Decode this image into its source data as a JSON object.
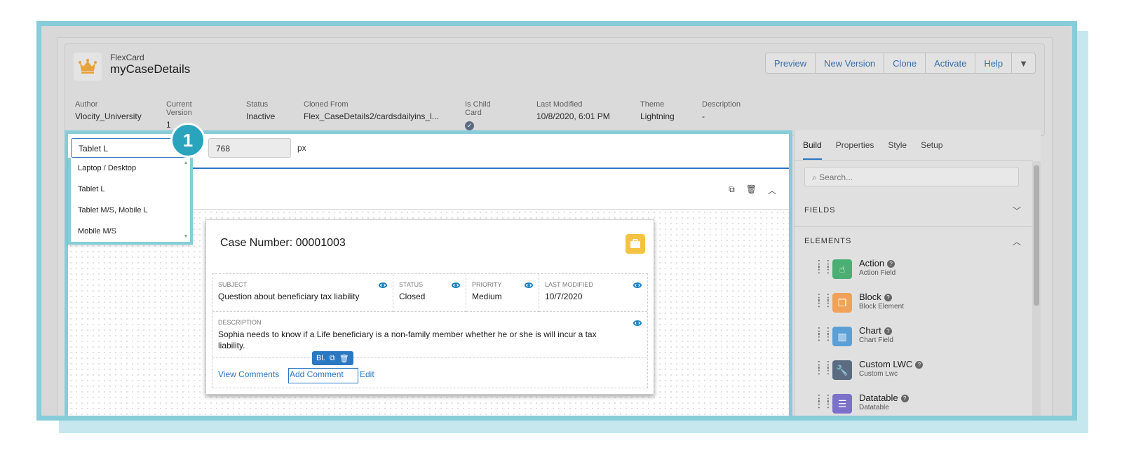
{
  "header": {
    "object_type": "FlexCard",
    "title": "myCaseDetails",
    "buttons": [
      "Preview",
      "New Version",
      "Clone",
      "Activate",
      "Help"
    ],
    "fields": [
      {
        "label": "Author",
        "value": "Vlocity_University"
      },
      {
        "label": "Current Version",
        "value": "1"
      },
      {
        "label": "Status",
        "value": "Inactive"
      },
      {
        "label": "Cloned From",
        "value": "Flex_CaseDetails2/cardsdailyins_l..."
      },
      {
        "label": "Is Child Card",
        "value": ""
      },
      {
        "label": "Last Modified",
        "value": "10/8/2020, 6:01 PM"
      },
      {
        "label": "Theme",
        "value": "Lightning"
      },
      {
        "label": "Description",
        "value": "-"
      }
    ]
  },
  "canvas": {
    "device_select_value": "Tablet L",
    "width_value": "768",
    "width_unit": "px",
    "device_options": [
      "Laptop / Desktop",
      "Tablet L",
      "Tablet M/S, Mobile L",
      "Mobile M/S"
    ],
    "step_badge": "1"
  },
  "card": {
    "title": "Case Number: 00001003",
    "fields": [
      {
        "label": "Subject",
        "value": "Question about beneficiary tax liability"
      },
      {
        "label": "Status",
        "value": "Closed"
      },
      {
        "label": "Priority",
        "value": "Medium"
      },
      {
        "label": "Last Modified",
        "value": "10/7/2020"
      }
    ],
    "description_label": "Description",
    "description_value": "Sophia needs to know if a Life beneficiary is a non-family member whether he or she is will incur a tax liability.",
    "actions": [
      "View Comments",
      "Add Comment",
      "Edit"
    ],
    "block_tool_label": "Bl."
  },
  "panel": {
    "tabs": [
      "Build",
      "Properties",
      "Style",
      "Setup"
    ],
    "active_tab": "Build",
    "search_placeholder": "Search...",
    "sections": [
      "FIELDS",
      "ELEMENTS"
    ],
    "elements": [
      {
        "name": "Action",
        "sub": "Action Field",
        "icon": "touch-icon",
        "color": "#4bae73"
      },
      {
        "name": "Block",
        "sub": "Block Element",
        "icon": "block-icon",
        "color": "#f0a358"
      },
      {
        "name": "Chart",
        "sub": "Chart Field",
        "icon": "chart-icon",
        "color": "#5a9fd6"
      },
      {
        "name": "Custom LWC",
        "sub": "Custom Lwc",
        "icon": "wrench-icon",
        "color": "#5b6b82"
      },
      {
        "name": "Datatable",
        "sub": "Datatable",
        "icon": "table-icon",
        "color": "#7b71c9"
      }
    ]
  }
}
